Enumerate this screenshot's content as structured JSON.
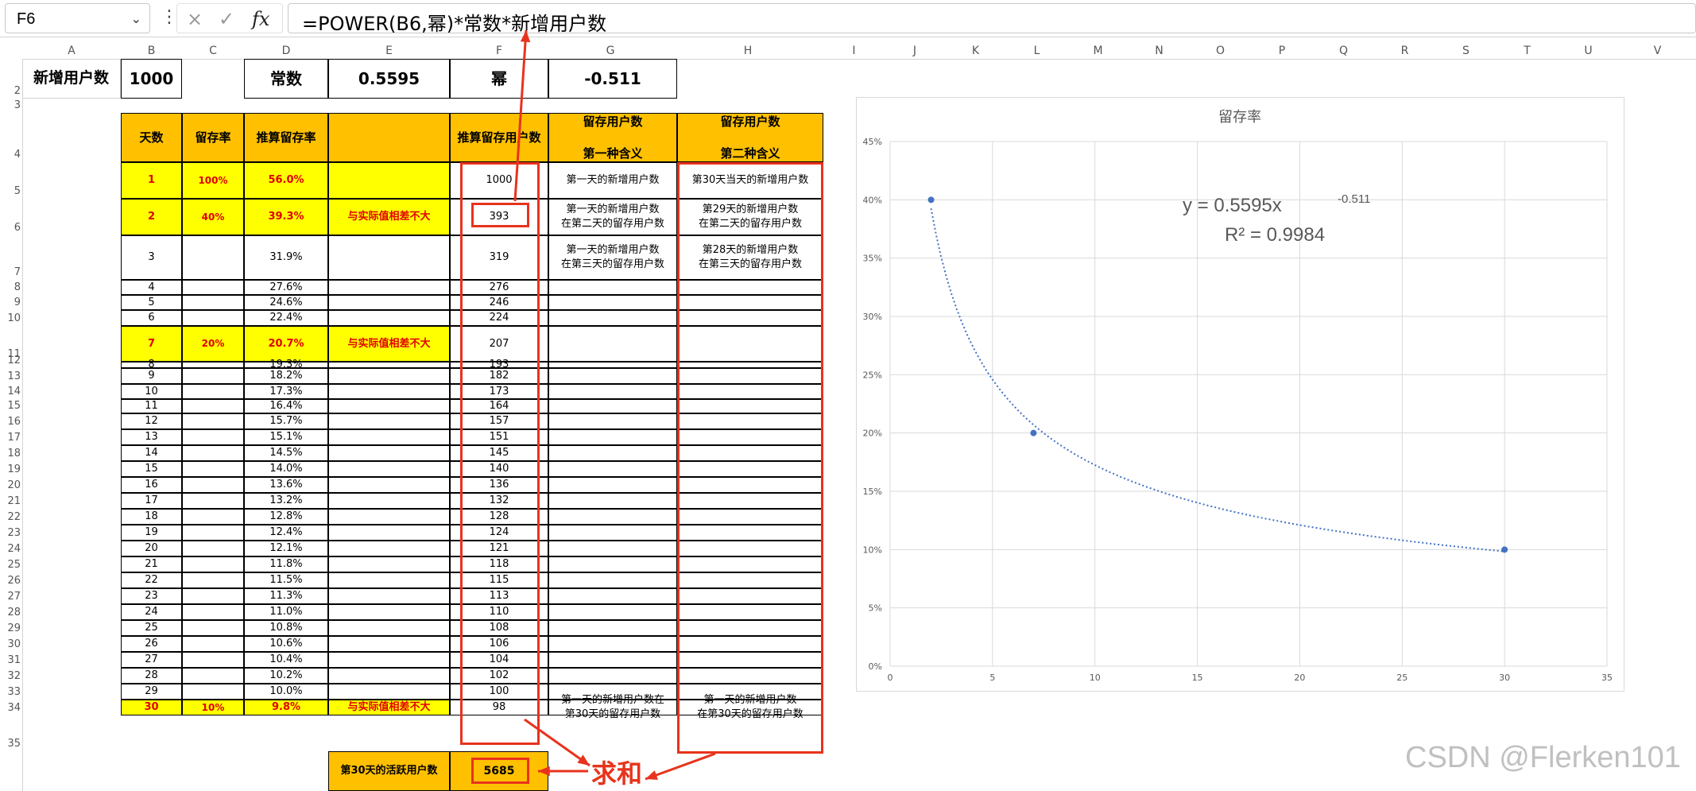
{
  "formula_bar": {
    "name_box": "F6",
    "formula": "=POWER(B6,幂)*常数*新增用户数",
    "cancel_icon": "×",
    "enter_icon": "✓",
    "fx_icon": "fx"
  },
  "columns": [
    "A",
    "B",
    "C",
    "D",
    "E",
    "F",
    "G",
    "H",
    "I",
    "J",
    "K",
    "L",
    "M",
    "N",
    "O",
    "P",
    "Q",
    "R",
    "S",
    "T",
    "U",
    "V"
  ],
  "rows": [
    "2",
    "3",
    "4",
    "5",
    "6",
    "7",
    "8",
    "9",
    "10",
    "11",
    "12",
    "13",
    "14",
    "15",
    "16",
    "17",
    "18",
    "19",
    "20",
    "21",
    "22",
    "23",
    "24",
    "25",
    "26",
    "27",
    "28",
    "29",
    "30",
    "31",
    "32",
    "33",
    "34",
    "35"
  ],
  "params": {
    "new_users_label": "新增用户数",
    "new_users_value": "1000",
    "const_label": "常数",
    "const_value": "0.5595",
    "power_label": "幂",
    "power_value": "-0.511"
  },
  "table_headers": {
    "day": "天数",
    "retention": "留存率",
    "est_retention": "推算留存率",
    "note": "",
    "est_users": "推算留存用户数",
    "meaning1_a": "留存用户数",
    "meaning1_b": "第一种含义",
    "meaning2_a": "留存用户数",
    "meaning2_b": "第二种含义"
  },
  "table_rows": [
    {
      "day": "1",
      "ret": "100%",
      "est": "56.0%",
      "note": "",
      "users": "1000",
      "m1": "第一天的新增用户数",
      "m2": "第30天当天的新增用户数"
    },
    {
      "day": "2",
      "ret": "40%",
      "est": "39.3%",
      "note": "与实际值相差不大",
      "users": "393",
      "m1": "第一天的新增用户数\n在第二天的留存用户数",
      "m2": "第29天的新增用户数\n在第二天的留存用户数"
    },
    {
      "day": "3",
      "ret": "",
      "est": "31.9%",
      "note": "",
      "users": "319",
      "m1": "第一天的新增用户数\n在第三天的留存用户数",
      "m2": "第28天的新增用户数\n在第三天的留存用户数"
    },
    {
      "day": "4",
      "ret": "",
      "est": "27.6%",
      "note": "",
      "users": "276",
      "m1": "",
      "m2": ""
    },
    {
      "day": "5",
      "ret": "",
      "est": "24.6%",
      "note": "",
      "users": "246",
      "m1": "",
      "m2": ""
    },
    {
      "day": "6",
      "ret": "",
      "est": "22.4%",
      "note": "",
      "users": "224",
      "m1": "",
      "m2": ""
    },
    {
      "day": "7",
      "ret": "20%",
      "est": "20.7%",
      "note": "与实际值相差不大",
      "users": "207",
      "m1": "",
      "m2": ""
    },
    {
      "day": "8",
      "ret": "",
      "est": "19.3%",
      "note": "",
      "users": "193",
      "m1": "",
      "m2": ""
    },
    {
      "day": "9",
      "ret": "",
      "est": "18.2%",
      "note": "",
      "users": "182",
      "m1": "",
      "m2": ""
    },
    {
      "day": "10",
      "ret": "",
      "est": "17.3%",
      "note": "",
      "users": "173",
      "m1": "",
      "m2": ""
    },
    {
      "day": "11",
      "ret": "",
      "est": "16.4%",
      "note": "",
      "users": "164",
      "m1": "",
      "m2": ""
    },
    {
      "day": "12",
      "ret": "",
      "est": "15.7%",
      "note": "",
      "users": "157",
      "m1": "",
      "m2": ""
    },
    {
      "day": "13",
      "ret": "",
      "est": "15.1%",
      "note": "",
      "users": "151",
      "m1": "",
      "m2": ""
    },
    {
      "day": "14",
      "ret": "",
      "est": "14.5%",
      "note": "",
      "users": "145",
      "m1": "",
      "m2": ""
    },
    {
      "day": "15",
      "ret": "",
      "est": "14.0%",
      "note": "",
      "users": "140",
      "m1": "",
      "m2": ""
    },
    {
      "day": "16",
      "ret": "",
      "est": "13.6%",
      "note": "",
      "users": "136",
      "m1": "",
      "m2": ""
    },
    {
      "day": "17",
      "ret": "",
      "est": "13.2%",
      "note": "",
      "users": "132",
      "m1": "",
      "m2": ""
    },
    {
      "day": "18",
      "ret": "",
      "est": "12.8%",
      "note": "",
      "users": "128",
      "m1": "",
      "m2": ""
    },
    {
      "day": "19",
      "ret": "",
      "est": "12.4%",
      "note": "",
      "users": "124",
      "m1": "",
      "m2": ""
    },
    {
      "day": "20",
      "ret": "",
      "est": "12.1%",
      "note": "",
      "users": "121",
      "m1": "",
      "m2": ""
    },
    {
      "day": "21",
      "ret": "",
      "est": "11.8%",
      "note": "",
      "users": "118",
      "m1": "",
      "m2": ""
    },
    {
      "day": "22",
      "ret": "",
      "est": "11.5%",
      "note": "",
      "users": "115",
      "m1": "",
      "m2": ""
    },
    {
      "day": "23",
      "ret": "",
      "est": "11.3%",
      "note": "",
      "users": "113",
      "m1": "",
      "m2": ""
    },
    {
      "day": "24",
      "ret": "",
      "est": "11.0%",
      "note": "",
      "users": "110",
      "m1": "",
      "m2": ""
    },
    {
      "day": "25",
      "ret": "",
      "est": "10.8%",
      "note": "",
      "users": "108",
      "m1": "",
      "m2": ""
    },
    {
      "day": "26",
      "ret": "",
      "est": "10.6%",
      "note": "",
      "users": "106",
      "m1": "",
      "m2": ""
    },
    {
      "day": "27",
      "ret": "",
      "est": "10.4%",
      "note": "",
      "users": "104",
      "m1": "",
      "m2": ""
    },
    {
      "day": "28",
      "ret": "",
      "est": "10.2%",
      "note": "",
      "users": "102",
      "m1": "",
      "m2": ""
    },
    {
      "day": "29",
      "ret": "",
      "est": "10.0%",
      "note": "",
      "users": "100",
      "m1": "",
      "m2": ""
    },
    {
      "day": "30",
      "ret": "10%",
      "est": "9.8%",
      "note": "与实际值相差不大",
      "users": "98",
      "m1": "第一天的新增用户数在\n第30天的留存用户数",
      "m2": "第一天的新增用户数\n在第30天的留存用户数"
    }
  ],
  "total": {
    "label": "第30天的活跃用户数",
    "value": "5685"
  },
  "annotation": {
    "sum_label": "求和"
  },
  "watermark": "CSDN @Flerken101",
  "colors": {
    "header_orange": "#ffc000",
    "highlight_yellow": "#ffff00",
    "annotation_red": "#e8331c",
    "trend_blue": "#4472c4"
  },
  "chart_data": {
    "type": "scatter",
    "title": "留存率",
    "series": [
      {
        "x": [
          2,
          7,
          30
        ],
        "y": [
          0.4,
          0.2,
          0.1
        ]
      }
    ],
    "trendline": {
      "type": "power",
      "a": 0.5595,
      "b": -0.511,
      "equation": "y = 0.5595x",
      "exponent": "-0.511",
      "r2": "R² = 0.9984"
    },
    "xlim": [
      0,
      35
    ],
    "ylim": [
      0,
      0.45
    ],
    "xticks": [
      "0",
      "5",
      "10",
      "15",
      "20",
      "25",
      "30",
      "35"
    ],
    "yticks": [
      "0%",
      "5%",
      "10%",
      "15%",
      "20%",
      "25%",
      "30%",
      "35%",
      "40%",
      "45%"
    ],
    "grid": true
  }
}
